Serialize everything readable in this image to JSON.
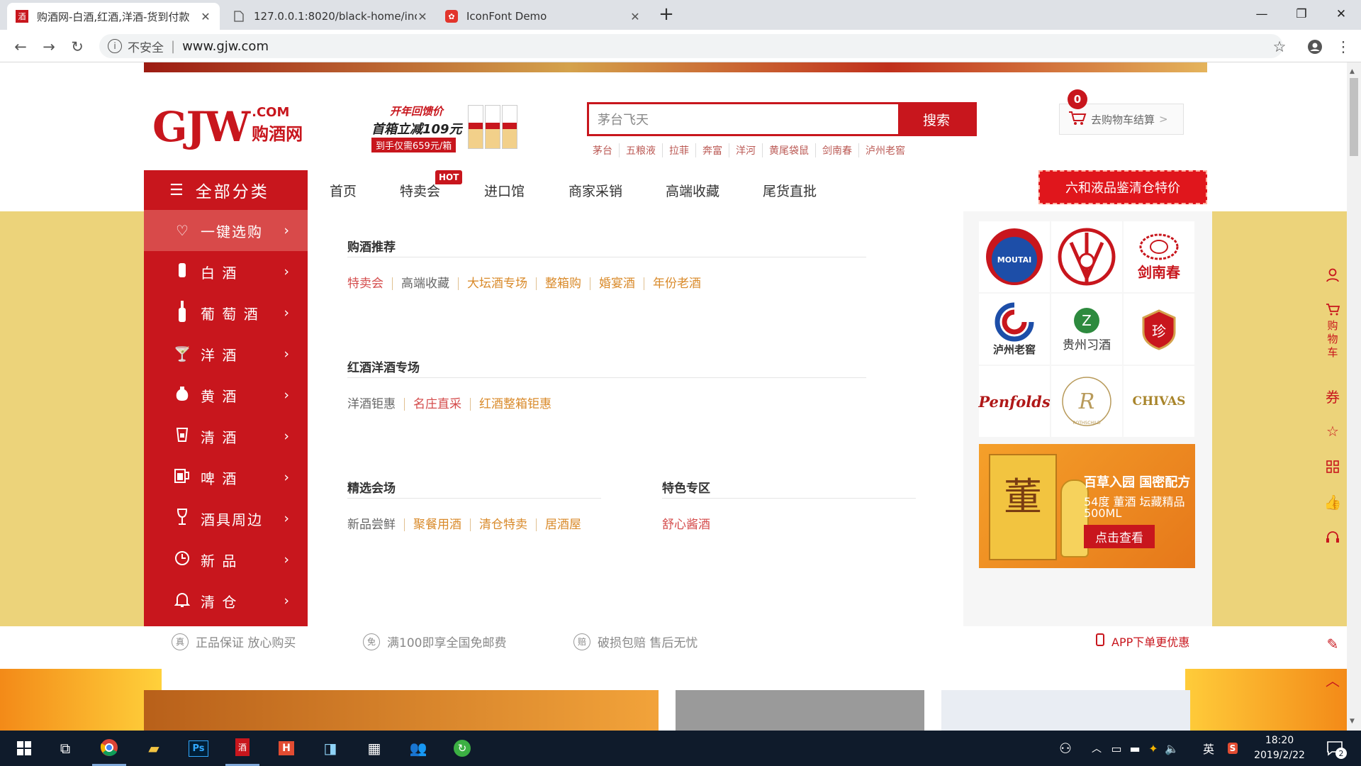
{
  "tabs": [
    {
      "title": "购酒网-白酒,红酒,洋酒-货到付款",
      "favicon": "酒",
      "active": true
    },
    {
      "title": "127.0.0.1:8020/black-home/inc",
      "favicon": "doc",
      "active": false
    },
    {
      "title": "IconFont Demo",
      "favicon": "iconfont",
      "active": false
    }
  ],
  "window_controls": [
    "minimize",
    "restore",
    "close"
  ],
  "address": {
    "security_label": "不安全",
    "url": "www.gjw.com"
  },
  "logo": {
    "text": "GJW",
    "sub": ".COM",
    "cn": "购酒网"
  },
  "promo": {
    "line1": "开年回馈价",
    "line2": "首箱立减109元",
    "line3": "到手仅需659元/箱"
  },
  "search": {
    "placeholder": "茅台飞天",
    "button": "搜索",
    "hot_words": [
      "茅台",
      "五粮液",
      "拉菲",
      "奔富",
      "洋河",
      "黄尾袋鼠",
      "剑南春",
      "泸州老窖"
    ]
  },
  "cart": {
    "count": "0",
    "label": "去购物车结算",
    "arrow": ">"
  },
  "nav": {
    "all_categories": "全部分类",
    "items": [
      "首页",
      "特卖会",
      "进口馆",
      "商家采销",
      "高端收藏",
      "尾货直批"
    ],
    "hot_badge": "HOT",
    "banner": "六和液品鉴清仓特价"
  },
  "sidebar": [
    {
      "label": "一键选购",
      "icon": "heart-icon"
    },
    {
      "label": "白 酒",
      "icon": "baijiu-bottle-icon"
    },
    {
      "label": "葡 萄 酒",
      "icon": "wine-bottle-icon"
    },
    {
      "label": "洋 酒",
      "icon": "cocktail-glass-icon"
    },
    {
      "label": "黄 酒",
      "icon": "jar-icon"
    },
    {
      "label": "清 酒",
      "icon": "sake-cup-icon"
    },
    {
      "label": "啤 酒",
      "icon": "beer-mug-icon"
    },
    {
      "label": "酒具周边",
      "icon": "wine-glass-icon"
    },
    {
      "label": "新 品",
      "icon": "clock-icon"
    },
    {
      "label": "清 仓",
      "icon": "bell-icon"
    }
  ],
  "sections": [
    {
      "title": "购酒推荐",
      "links": [
        "特卖会",
        "高端收藏",
        "大坛酒专场",
        "整箱购",
        "婚宴酒",
        "年份老酒"
      ]
    },
    {
      "title": "红酒洋酒专场",
      "links": [
        "洋酒钜惠",
        "名庄直采",
        "红酒整箱钜惠"
      ]
    },
    {
      "title": "精选会场",
      "links": [
        "新品尝鲜",
        "聚餐用酒",
        "清仓特卖",
        "居酒屋"
      ]
    },
    {
      "title": "特色专区",
      "links": [
        "舒心酱酒"
      ]
    }
  ],
  "brands": [
    "MOUTAI",
    "五粮液",
    "剑南春",
    "泸州老窖",
    "贵州习酒",
    "珍酒",
    "Penfolds",
    "ROTHSCHILD",
    "CHIVAS"
  ],
  "ad": {
    "title": "百草入园 国密配方",
    "line2": "54度 董酒 坛藏精品",
    "line3": "500ML",
    "cta": "点击查看"
  },
  "guarantees": [
    {
      "badge": "真",
      "text": "正品保证 放心购买"
    },
    {
      "badge": "免",
      "text": "满100即享全国免邮费"
    },
    {
      "badge": "赔",
      "text": "破损包赔 售后无忧"
    }
  ],
  "app_offer": "APP下单更优惠",
  "right_toolbar": {
    "cart_label": "购物车"
  },
  "taskbar": {
    "time": "18:20",
    "date": "2019/2/22",
    "ime": "英",
    "notification_count": "2"
  },
  "colors": {
    "brand_red": "#c8161d",
    "hero_yellow": "#ecd37a"
  }
}
